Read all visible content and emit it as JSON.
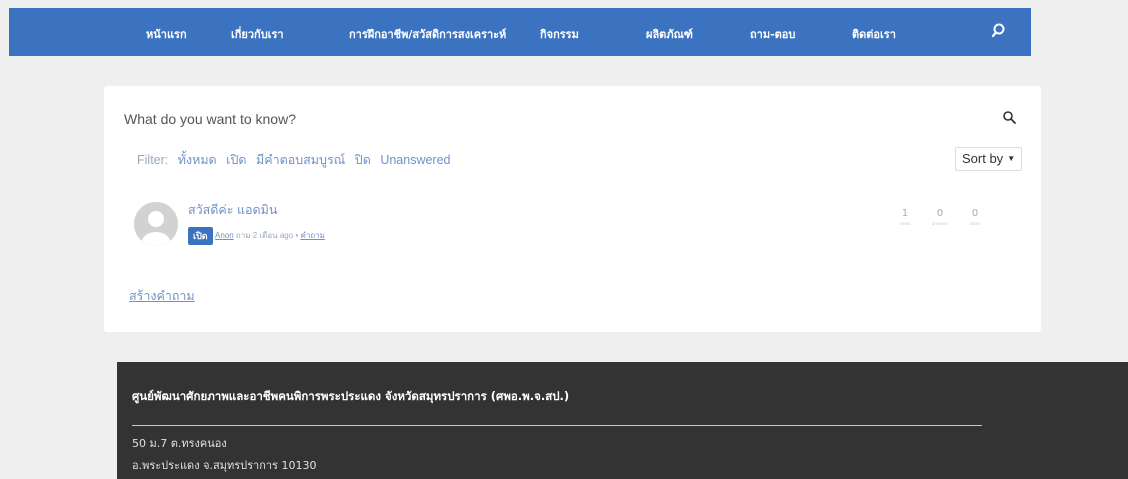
{
  "nav": {
    "items": [
      "หน้าแรก",
      "เกี่ยวกับเรา",
      "การฝึกอาชีพ/สวัสดิการสงเคราะห์",
      "กิจกรรม",
      "ผลิตภัณฑ์",
      "ถาม-ตอบ",
      "ติดต่อเรา"
    ],
    "search_icon": "search-icon",
    "bg_color": "#3b73c0"
  },
  "search": {
    "placeholder": "What do you want to know?",
    "icon": "search-icon"
  },
  "filter": {
    "label": "Filter:",
    "options": [
      "ทั้งหมด",
      "เปิด",
      "มีคำตอบสมบูรณ์",
      "ปิด",
      "Unanswered"
    ]
  },
  "sort": {
    "label": "Sort by"
  },
  "question": {
    "title": "สวัสดีค่ะ แอดมิน",
    "status": "เปิด",
    "author": "Anon",
    "meta_mid": "ถาม 2 เดือน ago •",
    "category": "คำถาม",
    "stats": [
      {
        "value": "1",
        "label": "views"
      },
      {
        "value": "0",
        "label": "answers"
      },
      {
        "value": "0",
        "label": "votes"
      }
    ]
  },
  "create_link": "สร้างคำถาม",
  "footer": {
    "title": "ศูนย์พัฒนาศักยภาพและอาชีพคนพิการพระประแดง จังหวัดสมุทรปราการ (ศพอ.พ.จ.สป.)",
    "address_line1": "50  ม.7 ต.ทรงคนอง",
    "address_line2": "อ.พระประแดง จ.สมุทรปราการ  10130",
    "bg_color": "#333333"
  }
}
